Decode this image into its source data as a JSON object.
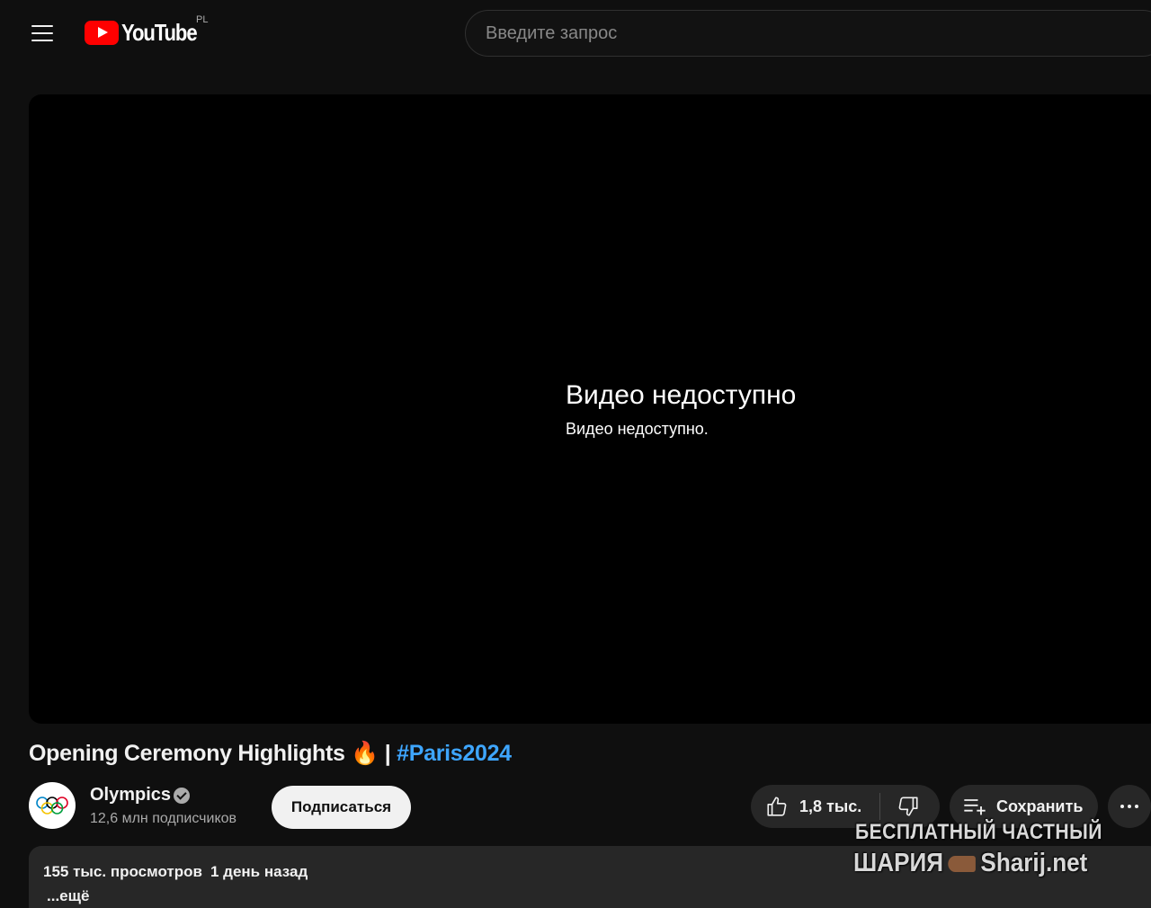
{
  "header": {
    "logo_text": "YouTube",
    "country_code": "PL",
    "search_placeholder": "Введите запрос"
  },
  "player": {
    "error_title": "Видео недоступно",
    "error_subtitle": "Видео недоступно."
  },
  "video": {
    "title": "Opening Ceremony Highlights 🔥 | ",
    "hashtag": "#Paris2024"
  },
  "channel": {
    "name": "Olympics",
    "subscribers": "12,6 млн подписчиков",
    "subscribe_label": "Подписаться",
    "avatar_icon": "olympic-rings-icon"
  },
  "actions": {
    "like_count": "1,8 тыс.",
    "save_label": "Сохранить"
  },
  "description": {
    "views": "155 тыс. просмотров",
    "date": "1 день назад",
    "more_label": "...ещё"
  },
  "watermark": {
    "line1": "БЕСПЛАТНЫЙ ЧАСТНЫЙ",
    "line2_left": "ШАРИЯ",
    "line2_right": "Sharij.net"
  },
  "colors": {
    "background": "#0f0f0f",
    "brand_red": "#ff0000",
    "hashtag_blue": "#3ea6ff",
    "button_dark": "#272727"
  }
}
